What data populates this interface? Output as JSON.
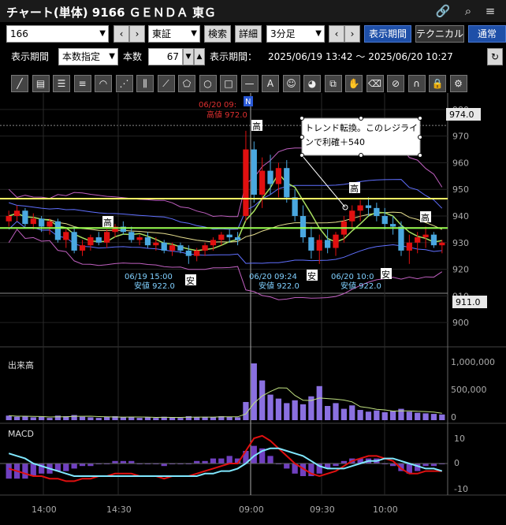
{
  "window": {
    "title": "チャート(単体) 9166 ＧＥＮＤＡ 東Ｇ"
  },
  "titlebar_icons": [
    "link-icon",
    "search-icon",
    "menu-icon"
  ],
  "toolbar1": {
    "symbol_value": "166",
    "market_value": "東証",
    "search_label": "検索",
    "detail_label": "詳細",
    "interval_value": "3分足",
    "display_period_label": "表示期間",
    "technical_label": "テクニカル",
    "normal_label": "通常"
  },
  "toolbar2": {
    "period_label": "表示期間",
    "period_value": "本数指定",
    "count_label": "本数",
    "count_value": "67",
    "range_label": "表示期間：",
    "range_value": "2025/06/19 13:42 〜 2025/06/20 10:27"
  },
  "drawing_tools": [
    "trendline-icon",
    "ruler-icon",
    "horizontal-lines-icon",
    "parallel-lines-icon",
    "arc-icon",
    "fan-icon",
    "vertical-lines-icon",
    "gann-fan-icon",
    "pentagon-icon",
    "circle-icon",
    "rectangle-icon",
    "horizontal-line-icon",
    "text-icon",
    "stamp-icon",
    "eraser-icon",
    "copy-icon",
    "hand-icon",
    "delete-icon",
    "delete-all-icon",
    "magnet-icon",
    "lock-icon",
    "settings-icon"
  ],
  "price_axis": {
    "ticks": [
      "980",
      "970",
      "960",
      "950",
      "940",
      "930",
      "920",
      "910",
      "900"
    ],
    "current_price": "974.0",
    "low_price": "911.0"
  },
  "time_axis": {
    "ticks": [
      "14:00",
      "14:30",
      "09:00",
      "09:30",
      "10:00"
    ]
  },
  "annotations": {
    "high_label": "06/20 09:",
    "high_value": "高値 972.0",
    "low1_date": "06/19 15:00",
    "low1_value": "安値 922.0",
    "low2_date": "06/20 09:24",
    "low2_value": "安値 922.0",
    "low3_date": "06/20 10:0",
    "low3_value": "安値 922.0",
    "note_text_line1": "トレンド転換。このレジライ",
    "note_text_line2": "ンで利確＋540",
    "marker_high": "高",
    "marker_low": "安",
    "news_marker": "N"
  },
  "volume_panel": {
    "label": "出来高",
    "ticks": [
      "1,000,000",
      "500,000",
      "0"
    ]
  },
  "macd_panel": {
    "label": "MACD",
    "ticks": [
      "10",
      "0",
      "-10"
    ]
  },
  "colors": {
    "up": "#e01010",
    "down": "#4aa8e0",
    "ma_short": "#a8e060",
    "ma_long": "#e8e090",
    "band_outer": "#c060c0",
    "band_inner": "#6070ff",
    "yellow_line": "#ffff66",
    "green_line": "#40ff40",
    "macd": "#e01010",
    "signal": "#80e8ff"
  },
  "chart_data": {
    "type": "candlestick",
    "ylim": [
      895,
      985
    ],
    "candles": [
      [
        938,
        942,
        936,
        940
      ],
      [
        940,
        944,
        938,
        942
      ],
      [
        942,
        943,
        936,
        937
      ],
      [
        937,
        941,
        935,
        939
      ],
      [
        939,
        940,
        934,
        936
      ],
      [
        936,
        939,
        933,
        938
      ],
      [
        938,
        939,
        930,
        931
      ],
      [
        931,
        935,
        928,
        934
      ],
      [
        934,
        936,
        926,
        927
      ],
      [
        927,
        931,
        925,
        929
      ],
      [
        929,
        933,
        927,
        932
      ],
      [
        932,
        934,
        929,
        930
      ],
      [
        930,
        935,
        928,
        934
      ],
      [
        934,
        937,
        932,
        936
      ],
      [
        936,
        938,
        933,
        934
      ],
      [
        934,
        936,
        930,
        931
      ],
      [
        931,
        933,
        929,
        932
      ],
      [
        932,
        934,
        928,
        929
      ],
      [
        929,
        932,
        927,
        930
      ],
      [
        930,
        931,
        926,
        927
      ],
      [
        927,
        930,
        925,
        929
      ],
      [
        929,
        930,
        926,
        927
      ],
      [
        927,
        929,
        922,
        925
      ],
      [
        925,
        928,
        923,
        927
      ],
      [
        927,
        930,
        925,
        929
      ],
      [
        929,
        932,
        927,
        931
      ],
      [
        931,
        934,
        929,
        933
      ],
      [
        933,
        935,
        930,
        932
      ],
      [
        932,
        934,
        929,
        931
      ],
      [
        940,
        972,
        938,
        965
      ],
      [
        965,
        968,
        945,
        948
      ],
      [
        948,
        962,
        943,
        957
      ],
      [
        957,
        963,
        948,
        952
      ],
      [
        952,
        960,
        947,
        958
      ],
      [
        958,
        961,
        945,
        947
      ],
      [
        947,
        950,
        938,
        940
      ],
      [
        940,
        944,
        930,
        932
      ],
      [
        932,
        936,
        924,
        927
      ],
      [
        927,
        933,
        922,
        931
      ],
      [
        931,
        935,
        926,
        928
      ],
      [
        928,
        934,
        925,
        933
      ],
      [
        933,
        940,
        930,
        938
      ],
      [
        938,
        944,
        935,
        942
      ],
      [
        942,
        946,
        938,
        944
      ],
      [
        944,
        947,
        940,
        943
      ],
      [
        943,
        945,
        938,
        940
      ],
      [
        940,
        943,
        935,
        937
      ],
      [
        937,
        940,
        933,
        936
      ],
      [
        936,
        938,
        925,
        927
      ],
      [
        927,
        933,
        922,
        930
      ],
      [
        930,
        934,
        926,
        932
      ],
      [
        932,
        936,
        928,
        933
      ],
      [
        933,
        934,
        928,
        929
      ],
      [
        929,
        931,
        926,
        930
      ]
    ],
    "volume": [
      80,
      60,
      70,
      50,
      60,
      40,
      80,
      70,
      90,
      60,
      50,
      40,
      60,
      70,
      50,
      60,
      40,
      50,
      40,
      60,
      50,
      40,
      70,
      50,
      60,
      50,
      70,
      60,
      50,
      320,
      1000,
      700,
      450,
      380,
      300,
      350,
      280,
      420,
      600,
      250,
      300,
      200,
      260,
      180,
      150,
      170,
      140,
      160,
      200,
      150,
      130,
      120,
      110,
      100
    ],
    "macd": [
      -2,
      -3,
      -4,
      -5,
      -5,
      -6,
      -6,
      -7,
      -7,
      -6,
      -6,
      -5,
      -5,
      -4,
      -4,
      -4,
      -5,
      -5,
      -5,
      -6,
      -5,
      -5,
      -5,
      -4,
      -3,
      -2,
      -1,
      0,
      0,
      5,
      10,
      11,
      9,
      6,
      3,
      0,
      -2,
      -4,
      -5,
      -4,
      -3,
      -1,
      1,
      2,
      3,
      3,
      2,
      1,
      -2,
      -4,
      -4,
      -3,
      -3,
      -3
    ],
    "signal": [
      4,
      3,
      2,
      0,
      -1,
      -2,
      -3,
      -4,
      -5,
      -5,
      -5,
      -5,
      -5,
      -5,
      -5,
      -5,
      -5,
      -5,
      -5,
      -5,
      -5,
      -5,
      -5,
      -5,
      -4,
      -4,
      -3,
      -3,
      -2,
      0,
      3,
      5,
      6,
      6,
      5,
      4,
      3,
      1,
      -1,
      -2,
      -2,
      -2,
      -1,
      0,
      1,
      1,
      2,
      2,
      1,
      0,
      -1,
      -2,
      -2,
      -3
    ]
  }
}
